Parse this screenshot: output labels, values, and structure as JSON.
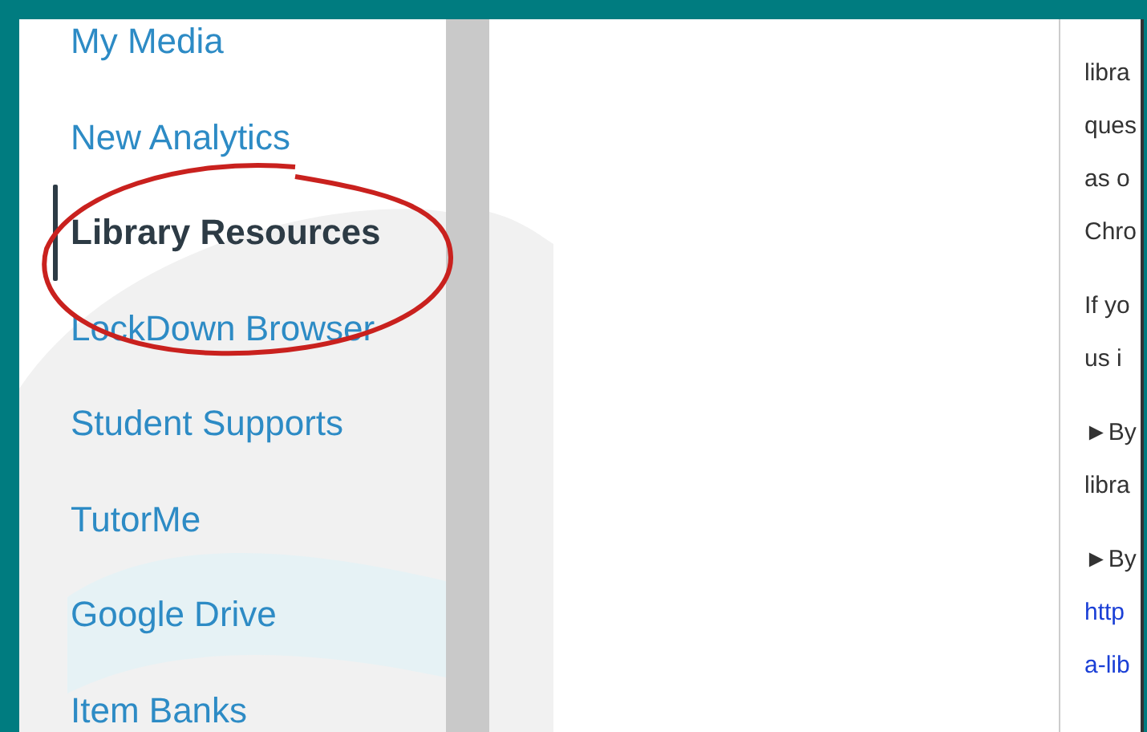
{
  "sidebar": {
    "items": [
      {
        "label": "My Media",
        "selected": false
      },
      {
        "label": "New Analytics",
        "selected": false
      },
      {
        "label": "Library Resources",
        "selected": true
      },
      {
        "label": "LockDown Browser",
        "selected": false
      },
      {
        "label": "Student Supports",
        "selected": false
      },
      {
        "label": "TutorMe",
        "selected": false
      },
      {
        "label": "Google Drive",
        "selected": false
      },
      {
        "label": "Item Banks",
        "selected": false
      }
    ]
  },
  "content": {
    "paragraphs": [
      {
        "lines": [
          {
            "text": "libra",
            "kind": "text"
          },
          {
            "text": "ques",
            "kind": "text"
          },
          {
            "text": "as o",
            "kind": "text"
          },
          {
            "text": "Chro",
            "kind": "text"
          }
        ]
      },
      {
        "lines": [
          {
            "text": "If yo",
            "kind": "text"
          },
          {
            "text": "us i",
            "kind": "text"
          }
        ]
      },
      {
        "lines": [
          {
            "text": "►By",
            "kind": "text"
          },
          {
            "text": "libra",
            "kind": "text"
          }
        ]
      },
      {
        "lines": [
          {
            "text": "►By",
            "kind": "text"
          },
          {
            "text": "http",
            "kind": "link"
          },
          {
            "text": "a-lib",
            "kind": "link"
          }
        ]
      }
    ]
  }
}
